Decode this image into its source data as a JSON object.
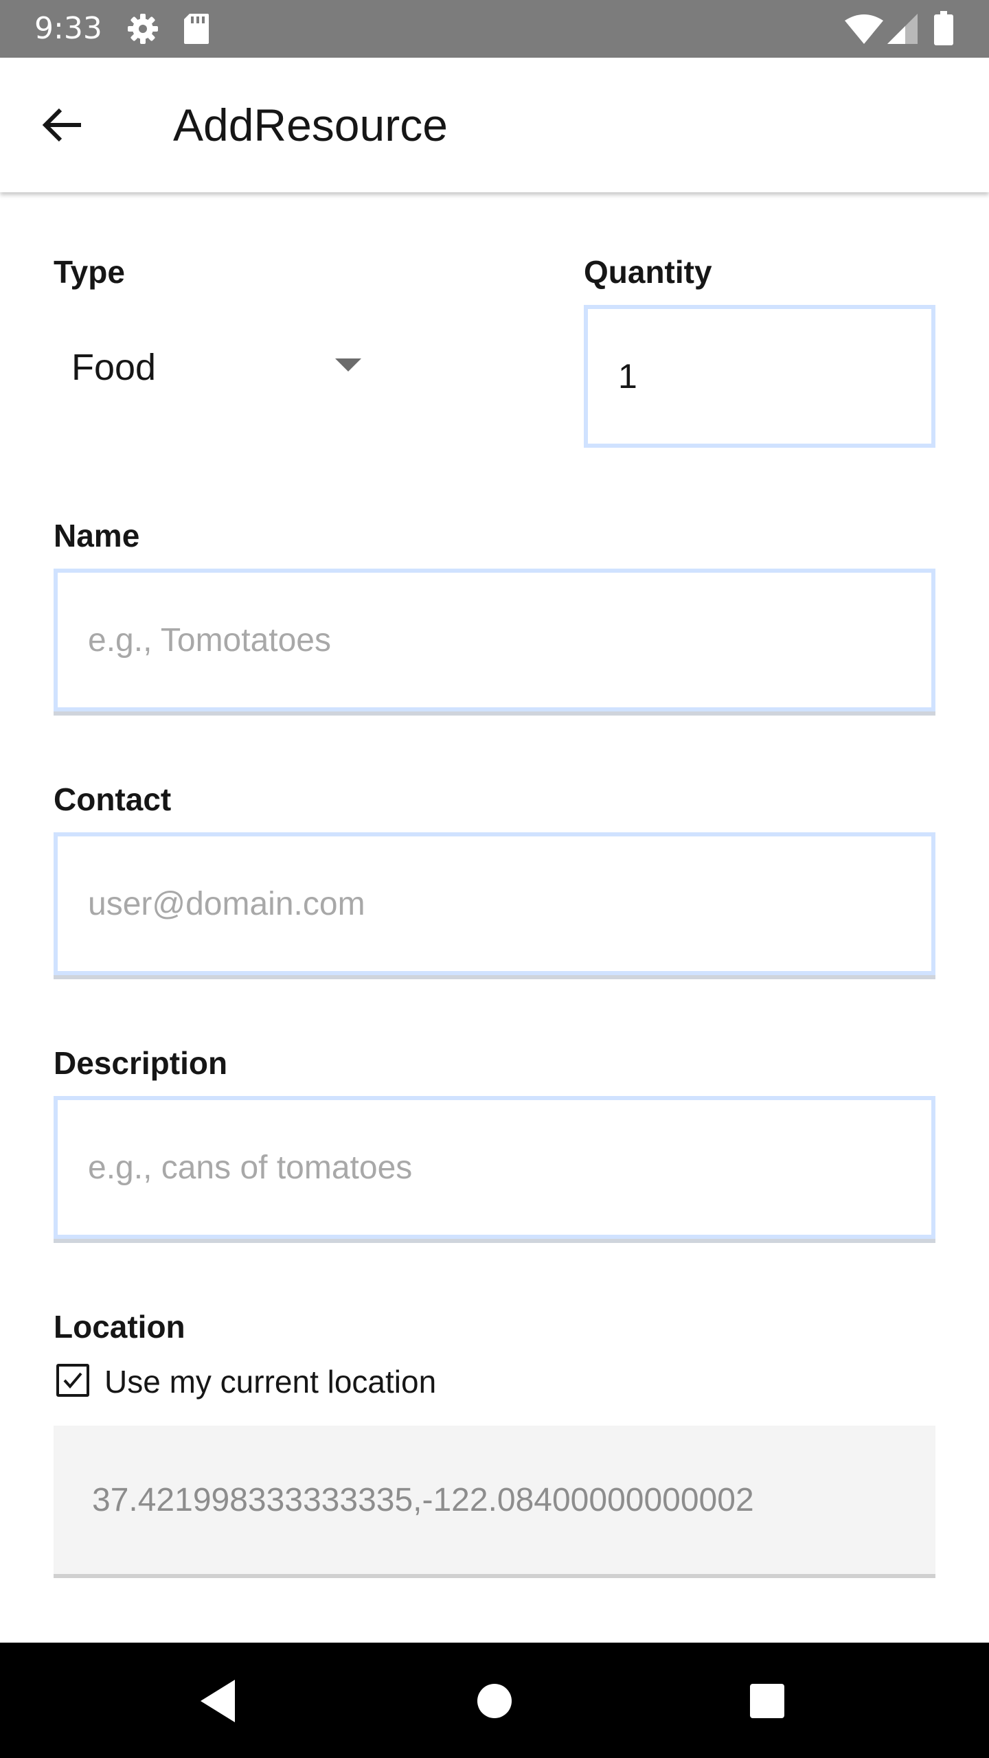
{
  "status_bar": {
    "time": "9:33",
    "icons": [
      "gear-icon",
      "sd-card-icon",
      "wifi-icon",
      "signal-icon",
      "battery-icon"
    ]
  },
  "app_bar": {
    "title": "AddResource",
    "back_icon": "arrow-left-icon"
  },
  "form": {
    "type": {
      "label": "Type",
      "value": "Food",
      "icon": "caret-down-icon"
    },
    "quantity": {
      "label": "Quantity",
      "value": "1"
    },
    "name": {
      "label": "Name",
      "placeholder": "e.g., Tomotatoes"
    },
    "contact": {
      "label": "Contact",
      "placeholder": "user@domain.com"
    },
    "description": {
      "label": "Description",
      "placeholder": "e.g., cans of tomatoes"
    },
    "location": {
      "label": "Location",
      "use_current_label": "Use my current location",
      "use_current_checked": true,
      "value": "37.421998333333335,-122.08400000000002"
    }
  },
  "nav_bar": {
    "icons": [
      "back-triangle-icon",
      "home-circle-icon",
      "recents-square-icon"
    ]
  },
  "colors": {
    "status_bar": "#7c7c7c",
    "field_border": "#d0e2ff",
    "placeholder": "#a8a8a8",
    "location_bg": "#f4f4f4",
    "nav_bar": "#000000"
  }
}
